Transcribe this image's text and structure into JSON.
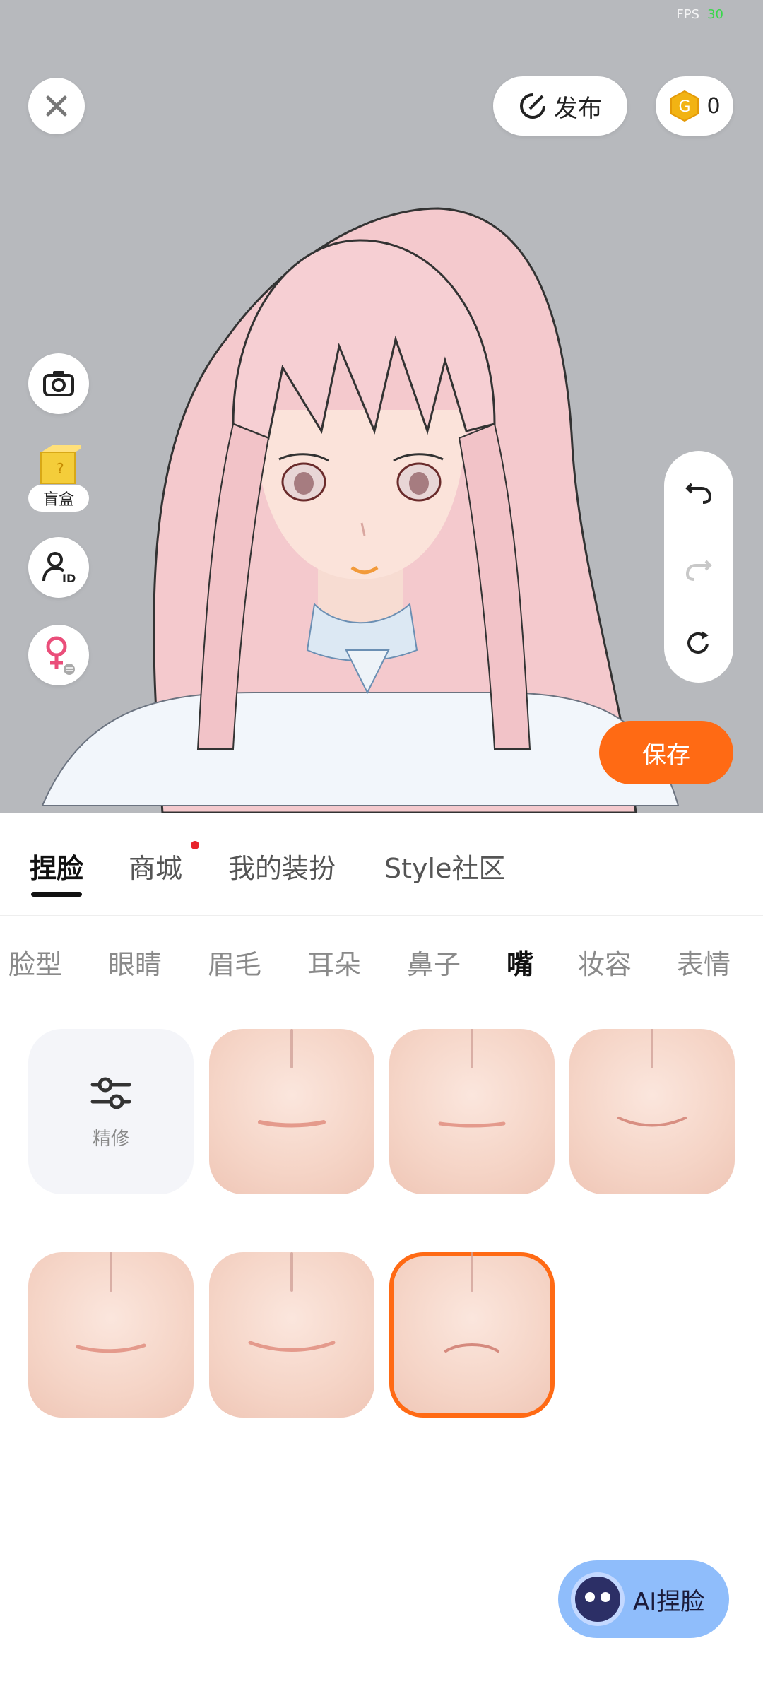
{
  "status": {
    "fps_label": "FPS",
    "fps_value": "30"
  },
  "top": {
    "publish_label": "发布",
    "coin_count": "0"
  },
  "side": {
    "blind_box_label": "盲盒"
  },
  "save_label": "保存",
  "main_tabs": [
    {
      "label": "捏脸",
      "active": true
    },
    {
      "label": "商城",
      "badge": true
    },
    {
      "label": "我的装扮"
    },
    {
      "label": "Style社区"
    }
  ],
  "sub_tabs": [
    {
      "label": "脸型"
    },
    {
      "label": "眼睛"
    },
    {
      "label": "眉毛"
    },
    {
      "label": "耳朵"
    },
    {
      "label": "鼻子"
    },
    {
      "label": "嘴",
      "active": true
    },
    {
      "label": "妆容"
    },
    {
      "label": "表情"
    }
  ],
  "options": {
    "refine_label": "精修",
    "selected_index": 6
  },
  "ai_label": "AI捏脸",
  "colors": {
    "accent": "#ff6a14",
    "viewport_bg": "#b7b9bd",
    "ai_button": "#8fbdfb"
  }
}
